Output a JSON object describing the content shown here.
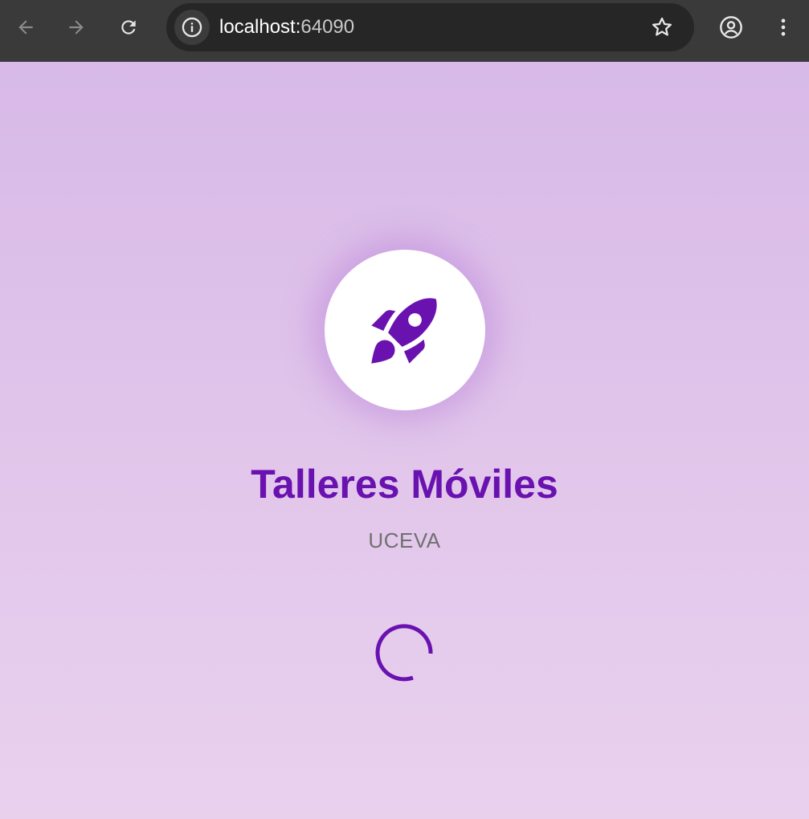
{
  "browser": {
    "url_host": "localhost:",
    "url_port": "64090",
    "icons": {
      "back": "arrow-left-icon",
      "forward": "arrow-right-icon",
      "reload": "reload-icon",
      "info": "info-icon",
      "bookmark": "star-icon",
      "profile": "account-circle-icon",
      "menu": "kebab-menu-icon"
    }
  },
  "app": {
    "title": "Talleres Móviles",
    "subtitle": "UCEVA",
    "logo_icon": "rocket-icon",
    "loading_indicator": "circular-progress-spinner"
  },
  "colors": {
    "primary": "#6a12b0",
    "subtitle": "#707070",
    "background_top": "#d8b9e8",
    "background_bottom": "#e9d1ee",
    "browser_bar": "#3a3a3a",
    "address_bar": "#262626"
  }
}
